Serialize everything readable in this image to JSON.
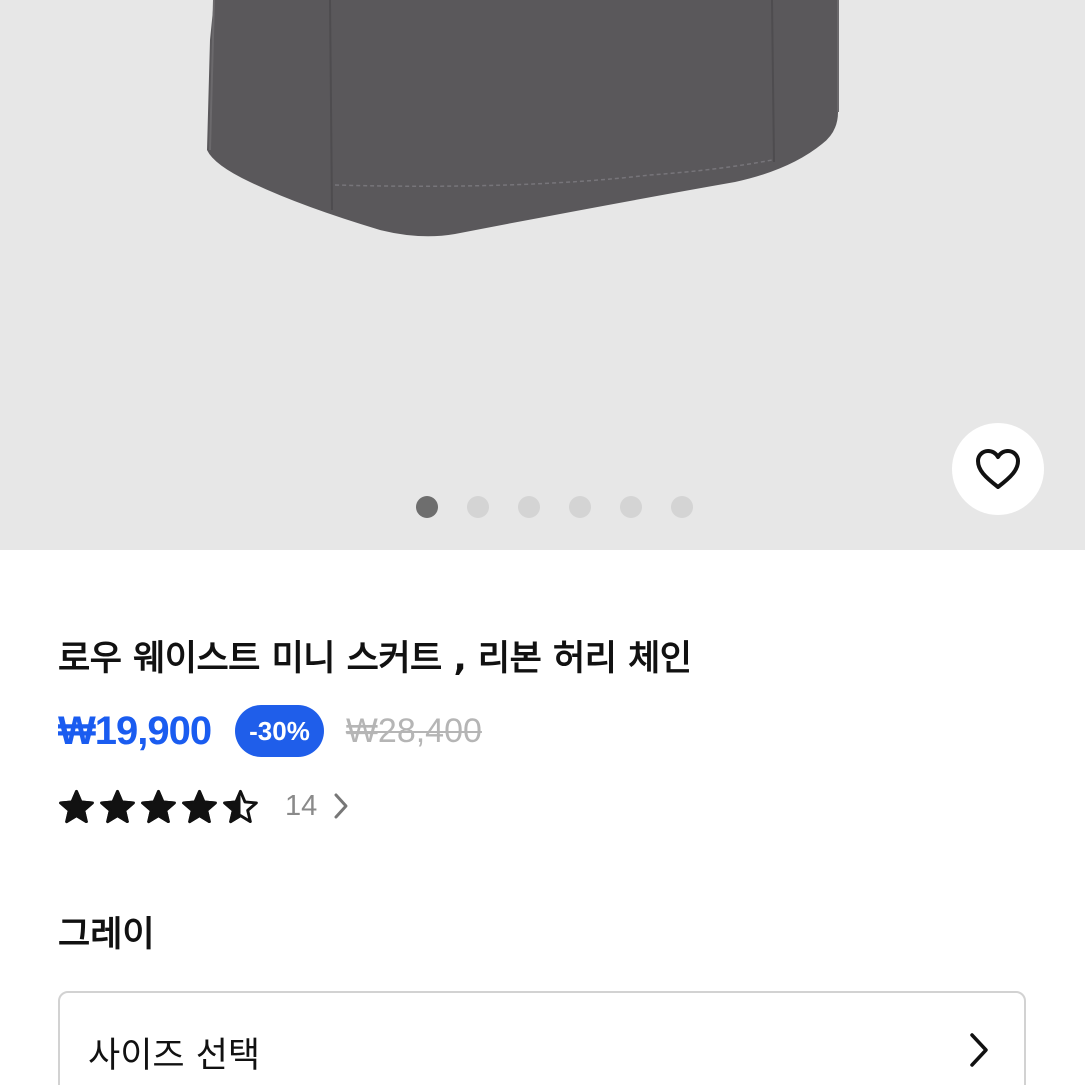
{
  "gallery": {
    "page_count": 6,
    "active_index": 0,
    "wishlist_icon": "heart-outline-icon",
    "background_color": "#e7e7e7",
    "garment_color": "#5a585b"
  },
  "product": {
    "title": "로우 웨이스트 미니 스커트 , 리본 허리 체인",
    "price": "₩19,900",
    "discount": "-30%",
    "original_price": "₩28,400",
    "rating": 4.5,
    "rating_max": 5,
    "review_count": "14",
    "color": "그레이"
  },
  "size_selector": {
    "label": "사이즈 선택",
    "icon": "chevron-right-icon"
  },
  "colors": {
    "accent": "#1a5cf0",
    "badge": "#1f5eea",
    "muted": "#b5b5b5"
  }
}
